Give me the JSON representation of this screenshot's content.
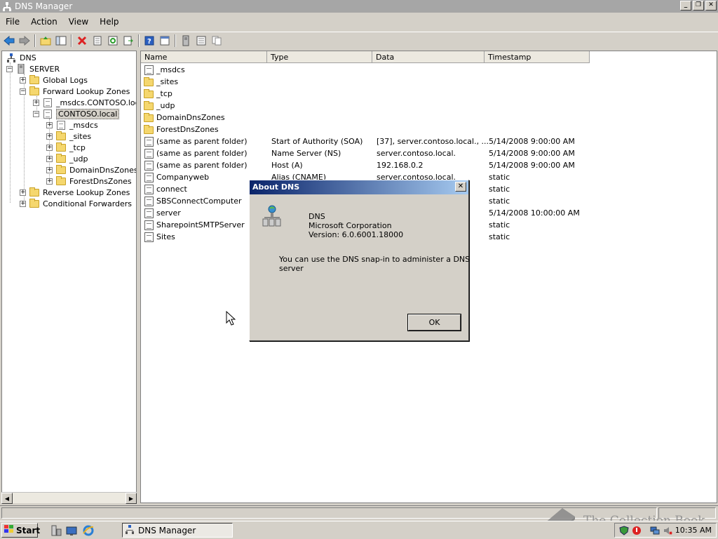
{
  "window": {
    "title": "DNS Manager"
  },
  "menu": [
    "File",
    "Action",
    "View",
    "Help"
  ],
  "tree": {
    "root": "DNS",
    "server": "SERVER",
    "global_logs": "Global Logs",
    "forward_zones": "Forward Lookup Zones",
    "msdcs_zone": "_msdcs.CONTOSO.local",
    "contoso_zone": "CONTOSO.local",
    "children": [
      "_msdcs",
      "_sites",
      "_tcp",
      "_udp",
      "DomainDnsZones",
      "ForestDnsZones"
    ],
    "reverse_zones": "Reverse Lookup Zones",
    "conditional_forwarders": "Conditional Forwarders"
  },
  "columns": [
    "Name",
    "Type",
    "Data",
    "Timestamp"
  ],
  "rows": [
    {
      "name": "_msdcs",
      "type": "",
      "data": "",
      "timestamp": "",
      "kind": "zone"
    },
    {
      "name": "_sites",
      "type": "",
      "data": "",
      "timestamp": "",
      "kind": "folder"
    },
    {
      "name": "_tcp",
      "type": "",
      "data": "",
      "timestamp": "",
      "kind": "folder"
    },
    {
      "name": "_udp",
      "type": "",
      "data": "",
      "timestamp": "",
      "kind": "folder"
    },
    {
      "name": "DomainDnsZones",
      "type": "",
      "data": "",
      "timestamp": "",
      "kind": "folder"
    },
    {
      "name": "ForestDnsZones",
      "type": "",
      "data": "",
      "timestamp": "",
      "kind": "folder"
    },
    {
      "name": "(same as parent folder)",
      "type": "Start of Authority (SOA)",
      "data": "[37], server.contoso.local., ...",
      "timestamp": "5/14/2008 9:00:00 AM",
      "kind": "record"
    },
    {
      "name": "(same as parent folder)",
      "type": "Name Server (NS)",
      "data": "server.contoso.local.",
      "timestamp": "5/14/2008 9:00:00 AM",
      "kind": "record"
    },
    {
      "name": "(same as parent folder)",
      "type": "Host (A)",
      "data": "192.168.0.2",
      "timestamp": "5/14/2008 9:00:00 AM",
      "kind": "record"
    },
    {
      "name": "Companyweb",
      "type": "Alias (CNAME)",
      "data": "server.contoso.local.",
      "timestamp": "static",
      "kind": "record"
    },
    {
      "name": "connect",
      "type": "",
      "data": "",
      "timestamp": "static",
      "kind": "record"
    },
    {
      "name": "SBSConnectComputer",
      "type": "",
      "data": "",
      "timestamp": "static",
      "kind": "record"
    },
    {
      "name": "server",
      "type": "",
      "data": "",
      "timestamp": "5/14/2008 10:00:00 AM",
      "kind": "record"
    },
    {
      "name": "SharepointSMTPServer",
      "type": "",
      "data": "",
      "timestamp": "static",
      "kind": "record"
    },
    {
      "name": "Sites",
      "type": "",
      "data": "",
      "timestamp": "static",
      "kind": "record"
    }
  ],
  "dialog": {
    "title": "About DNS",
    "product": "DNS",
    "company": "Microsoft Corporation",
    "version": "Version: 6.0.6001.18000",
    "description_line1": "You can use the DNS snap-in to administer a DNS",
    "description_line2": "server",
    "ok_label": "OK"
  },
  "taskbar": {
    "start_label": "Start",
    "task_label": "DNS Manager",
    "clock": "10:35 AM"
  },
  "watermark": "The Collection Book"
}
